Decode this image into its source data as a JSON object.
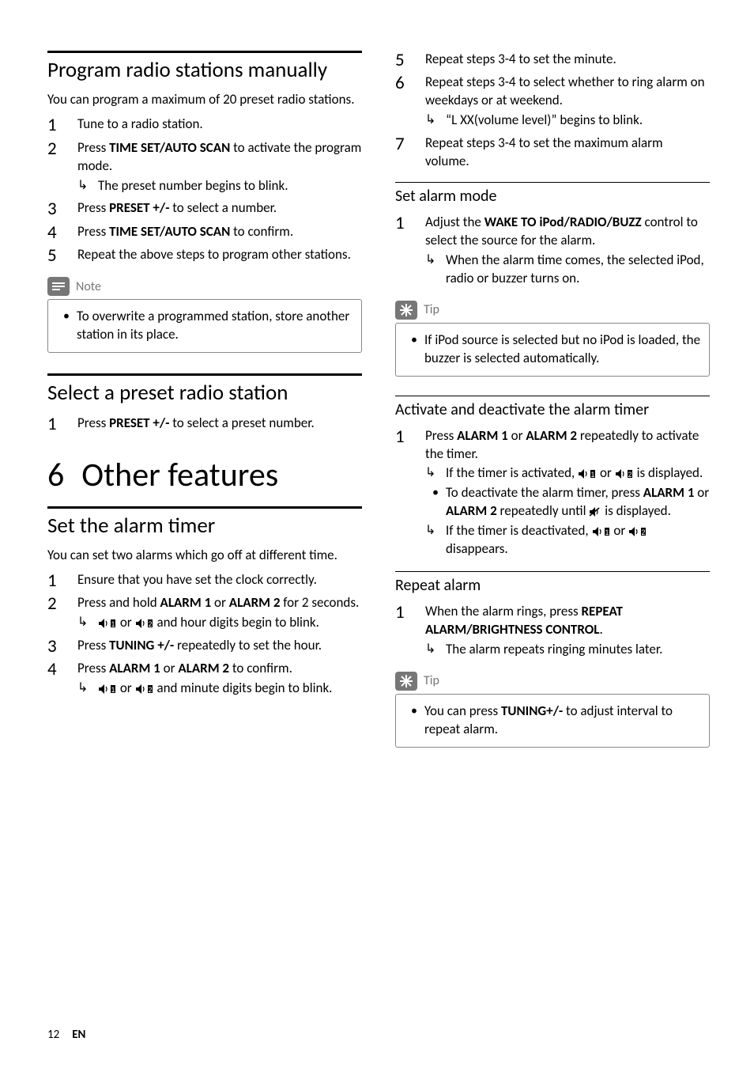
{
  "left": {
    "program": {
      "title": "Program radio stations manually",
      "intro": "You can program a maximum of 20 preset radio stations.",
      "steps": [
        {
          "n": "1",
          "text": "Tune to a radio station."
        },
        {
          "n": "2",
          "pre": "Press ",
          "b": "TIME SET/AUTO SCAN",
          "post": " to activate the program mode.",
          "res": [
            "The preset number begins to blink."
          ]
        },
        {
          "n": "3",
          "pre": "Press ",
          "b": "PRESET +/-",
          "post": " to select a number."
        },
        {
          "n": "4",
          "pre": "Press ",
          "b": "TIME SET/AUTO SCAN",
          "post": " to confirm."
        },
        {
          "n": "5",
          "text": "Repeat the above steps to program other stations."
        }
      ],
      "note_label": "Note",
      "note_item": "To overwrite a programmed station, store another station in its place."
    },
    "select": {
      "title": "Select a preset radio station",
      "steps": [
        {
          "n": "1",
          "pre": "Press ",
          "b": "PRESET +/-",
          "post": " to select a preset number."
        }
      ]
    },
    "chapter": {
      "num": "6",
      "title": "Other features"
    },
    "alarm": {
      "title": "Set the alarm timer",
      "intro": "You can set two alarms which go off at different time.",
      "steps": [
        {
          "n": "1",
          "text": "Ensure that you have set the clock correctly."
        },
        {
          "n": "2",
          "pre": "Press and hold ",
          "b": "ALARM 1",
          "mid": " or ",
          "b2": "ALARM 2",
          "post": " for 2 seconds.",
          "res_icons": "pair_hour"
        },
        {
          "n": "3",
          "pre": "Press ",
          "b": "TUNING +/-",
          "post": " repeatedly to set the hour."
        },
        {
          "n": "4",
          "pre": "Press ",
          "b": "ALARM 1",
          "mid": " or ",
          "b2": "ALARM 2",
          "post": " to confirm.",
          "res_icons": "pair_minute"
        }
      ],
      "res_hour_tail": " and hour digits begin to blink.",
      "res_minute_tail": " and minute digits begin to blink."
    }
  },
  "right": {
    "cont": {
      "steps": [
        {
          "n": "5",
          "text": "Repeat steps 3-4 to set the minute."
        },
        {
          "n": "6",
          "text": "Repeat steps 3-4 to select whether to ring alarm on weekdays or at weekend.",
          "res": [
            "“L XX(volume level)” begins to blink."
          ]
        },
        {
          "n": "7",
          "text": "Repeat steps 3-4 to set the maximum alarm volume."
        }
      ]
    },
    "mode": {
      "title": "Set alarm mode",
      "steps": [
        {
          "n": "1",
          "pre": "Adjust the ",
          "b": "WAKE TO iPod/RADIO/BUZZ",
          "post": " control to select the source for the alarm.",
          "res": [
            "When the alarm time comes, the selected iPod, radio or buzzer turns on."
          ]
        }
      ],
      "tip_label": "Tip",
      "tip_item": "If iPod source is selected but no iPod is loaded, the buzzer is selected automatically."
    },
    "activate": {
      "title": "Activate and deactivate the alarm timer",
      "steps": [
        {
          "n": "1",
          "pre": "Press ",
          "b": "ALARM 1",
          "mid": " or ",
          "b2": "ALARM 2",
          "post": " repeatedly to activate the timer."
        }
      ],
      "res1_pre": "If the timer is activated, ",
      "res1_or": " or ",
      "res1_tail": " is displayed.",
      "bul_pre": "To deactivate the alarm timer, press ",
      "bul_b1": "ALARM 1",
      "bul_mid": " or ",
      "bul_b2": "ALARM 2",
      "bul_post": " repeatedly until ",
      "bul_tail": " is displayed.",
      "res2_pre": "If the timer is deactivated, ",
      "res2_or": " or ",
      "res2_tail": " disappears."
    },
    "repeat": {
      "title": "Repeat alarm",
      "steps": [
        {
          "n": "1",
          "pre": "When the alarm rings, press ",
          "b": "REPEAT ALARM/BRIGHTNESS CONTROL",
          "post": ".",
          "res": [
            "The alarm repeats ringing minutes later."
          ]
        }
      ],
      "tip_label": "Tip",
      "tip_item_pre": "You can press ",
      "tip_item_b": "TUNING+/-",
      "tip_item_post": " to adjust interval to repeat alarm."
    }
  },
  "footer": {
    "page": "12",
    "lang": "EN"
  }
}
